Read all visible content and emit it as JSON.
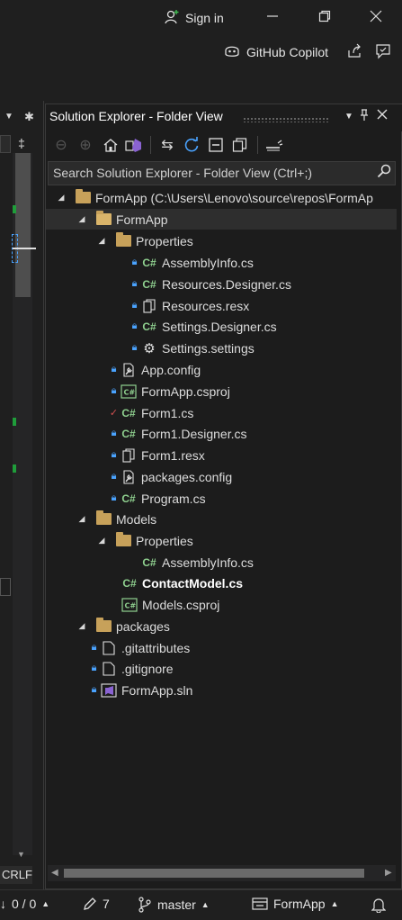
{
  "titlebar": {
    "signin_label": "Sign in",
    "copilot_label": "GitHub Copilot"
  },
  "panel": {
    "title": "Solution Explorer - Folder View",
    "search_placeholder": "Search Solution Explorer - Folder View (Ctrl+;)"
  },
  "tree": {
    "root": "FormApp (C:\\Users\\Lenovo\\source\\repos\\FormAp",
    "formapp": "FormApp",
    "properties1": "Properties",
    "assemblyinfo1": "AssemblyInfo.cs",
    "resources_designer": "Resources.Designer.cs",
    "resources_resx": "Resources.resx",
    "settings_designer": "Settings.Designer.cs",
    "settings_settings": "Settings.settings",
    "app_config": "App.config",
    "formapp_csproj": "FormApp.csproj",
    "form1_cs": "Form1.cs",
    "form1_designer": "Form1.Designer.cs",
    "form1_resx": "Form1.resx",
    "packages_config": "packages.config",
    "program_cs": "Program.cs",
    "models": "Models",
    "properties2": "Properties",
    "assemblyinfo2": "AssemblyInfo.cs",
    "contactmodel": "ContactModel.cs",
    "models_csproj": "Models.csproj",
    "packages": "packages",
    "gitattributes": ".gitattributes",
    "gitignore": ".gitignore",
    "formapp_sln": "FormApp.sln"
  },
  "editor": {
    "line_ending": "CRLF"
  },
  "statusbar": {
    "errors": "0 / 0",
    "changes": "7",
    "branch": "master",
    "repo": "FormApp"
  }
}
